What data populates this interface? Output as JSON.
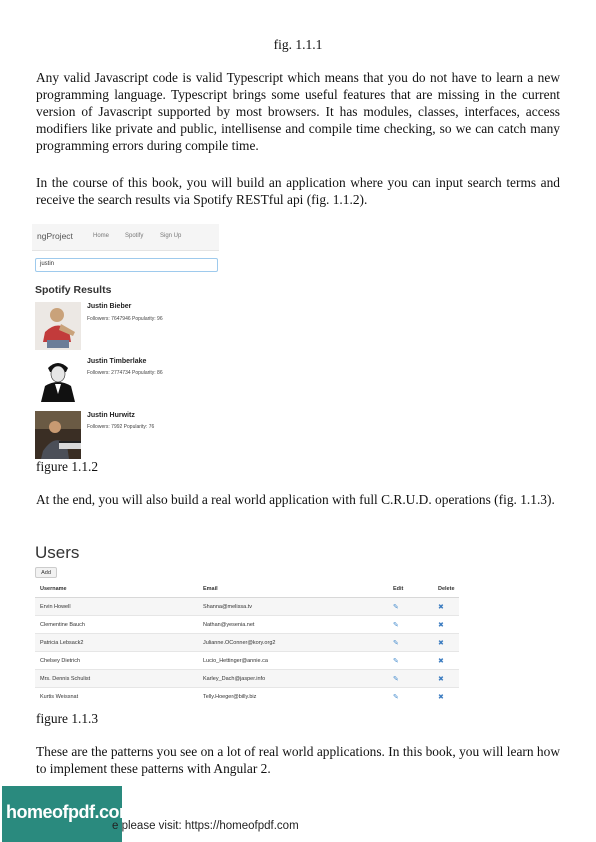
{
  "fig_caption_top": "fig. 1.1.1",
  "paragraph_1": "Any valid Javascript code is valid Typescript which means that you do not have to learn a new programming language. Typescript brings some useful features that are missing in the current version of Javascript supported by most browsers. It has modules, classes, interfaces, access modifiers like private and public, intellisense and compile time checking, so we can catch many programming errors during compile time.",
  "paragraph_2": "In the course of this book, you will build an application where you can input search terms and receive the search results via Spotify RESTful api (fig. 1.1.2).",
  "spotify": {
    "brand": "ngProject",
    "nav": [
      "Home",
      "Spotify",
      "Sign Up"
    ],
    "search_value": "justin",
    "title": "Spotify Results",
    "results": [
      {
        "name": "Justin Bieber",
        "meta": "Followers: 7647946 Popularity: 96"
      },
      {
        "name": "Justin Timberlake",
        "meta": "Followers: 2774734 Popularity: 86"
      },
      {
        "name": "Justin Hurwitz",
        "meta": "Followers: 7992 Popularity: 76"
      }
    ]
  },
  "caption_2": "figure 1.1.2",
  "paragraph_3": "At the end, you will also build a real world application with full C.R.U.D. operations (fig. 1.1.3).",
  "users": {
    "title": "Users",
    "add_label": "Add",
    "headers": [
      "Username",
      "Email",
      "Edit",
      "Delete"
    ],
    "rows": [
      {
        "username": "Ervin Howell",
        "email": "Shanna@melissa.tv"
      },
      {
        "username": "Clementine Bauch",
        "email": "Nathan@yesenia.net"
      },
      {
        "username": "Patricia Lebsack2",
        "email": "Julianne.OConner@kory.org2"
      },
      {
        "username": "Chelsey Dietrich",
        "email": "Lucio_Hettinger@annie.ca"
      },
      {
        "username": "Mrs. Dennis Schulist",
        "email": "Karley_Dach@jasper.info"
      },
      {
        "username": "Kurtis Weissnat",
        "email": "Telly.Hoeger@billy.biz"
      }
    ]
  },
  "caption_3": "figure 1.1.3",
  "paragraph_4": "These are the patterns you see on a lot of real world applications. In this book, you will learn how to implement these patterns with Angular 2.",
  "footer": {
    "logo_text": "homeofpdf.com",
    "text": "e please visit: https://homeofpdf.com"
  }
}
